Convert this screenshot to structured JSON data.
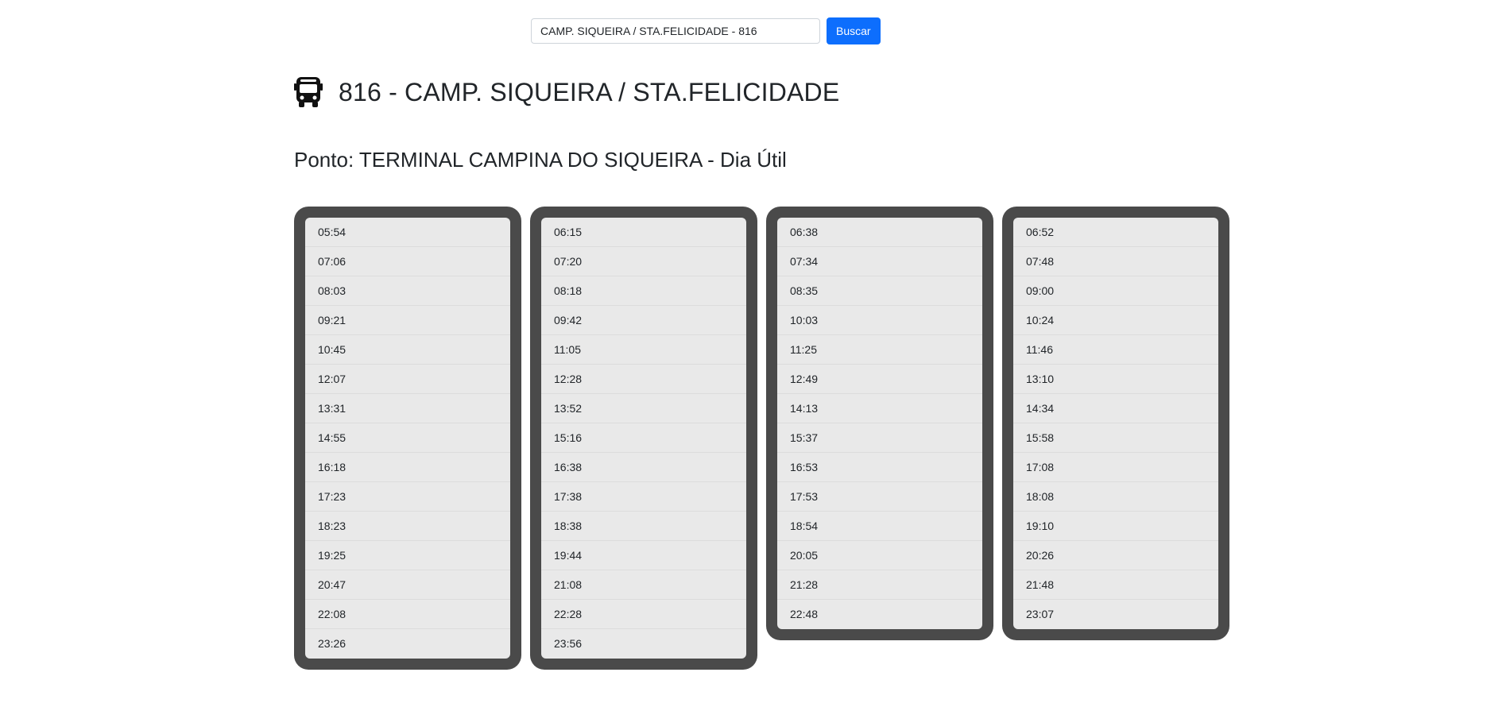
{
  "search": {
    "value": "CAMP. SIQUEIRA / STA.FELICIDADE - 816",
    "button_label": "Buscar"
  },
  "route": {
    "icon": "bus-icon",
    "title": "816 - CAMP. SIQUEIRA / STA.FELICIDADE"
  },
  "stop": {
    "title": "Ponto: TERMINAL CAMPINA DO SIQUEIRA - Dia Útil"
  },
  "colors": {
    "column_bg": "#4a4a4a",
    "item_bg": "#e9e9e9",
    "button_bg": "#0d6efd"
  },
  "columns": [
    [
      "05:54",
      "07:06",
      "08:03",
      "09:21",
      "10:45",
      "12:07",
      "13:31",
      "14:55",
      "16:18",
      "17:23",
      "18:23",
      "19:25",
      "20:47",
      "22:08",
      "23:26"
    ],
    [
      "06:15",
      "07:20",
      "08:18",
      "09:42",
      "11:05",
      "12:28",
      "13:52",
      "15:16",
      "16:38",
      "17:38",
      "18:38",
      "19:44",
      "21:08",
      "22:28",
      "23:56"
    ],
    [
      "06:38",
      "07:34",
      "08:35",
      "10:03",
      "11:25",
      "12:49",
      "14:13",
      "15:37",
      "16:53",
      "17:53",
      "18:54",
      "20:05",
      "21:28",
      "22:48"
    ],
    [
      "06:52",
      "07:48",
      "09:00",
      "10:24",
      "11:46",
      "13:10",
      "14:34",
      "15:58",
      "17:08",
      "18:08",
      "19:10",
      "20:26",
      "21:48",
      "23:07"
    ]
  ]
}
